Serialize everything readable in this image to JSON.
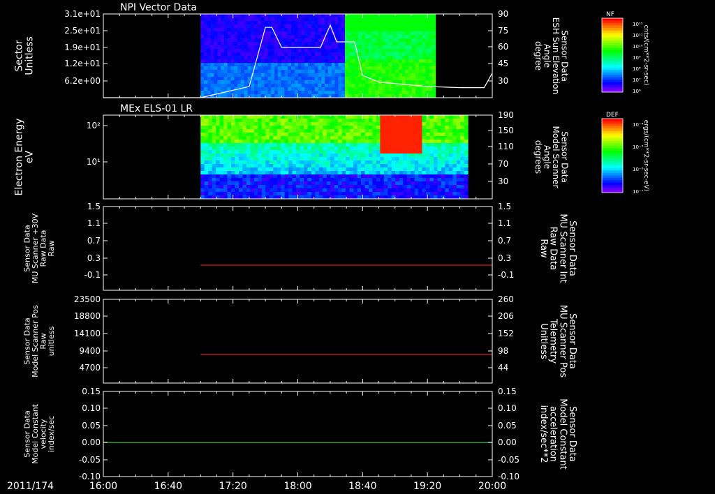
{
  "colors": {
    "background": "#000000",
    "axis": "#ffffff",
    "red_trace": "#ff2a2a",
    "green_trace": "#22dd22"
  },
  "x_axis": {
    "date_label": "2011/174",
    "ticks": [
      "16:00",
      "16:40",
      "17:20",
      "18:00",
      "18:40",
      "19:20",
      "20:00"
    ]
  },
  "chart_data": [
    {
      "type": "heatmap",
      "title": "NPI Vector Data",
      "ylabel": "Sector\nUnitless",
      "yticks": [
        "3.1e+01",
        "2.5e+01",
        "1.9e+01",
        "1.2e+01",
        "6.2e+00"
      ],
      "right_ylabel": "Sensor Data\nESH Sun Elevation\nAngle\ndegree",
      "right_yticks": [
        "90",
        "75",
        "60",
        "45",
        "30"
      ],
      "right_ylim": [
        15,
        90
      ],
      "colorbar": {
        "title": "NF",
        "units": "cnts/(cm**2-sr-sec)",
        "ticks": [
          "10¹²",
          "10¹¹",
          "10¹⁰",
          "10⁹",
          "10⁸",
          "10⁷",
          "10⁶"
        ]
      },
      "data_extent_time": [
        "17:00",
        "19:25"
      ],
      "line_series": {
        "name": "ESH Sun Elevation Angle",
        "x": [
          "16:00",
          "17:00",
          "17:30",
          "17:40",
          "17:44",
          "17:50",
          "18:00",
          "18:14",
          "18:20",
          "18:24",
          "18:35",
          "18:40",
          "18:50",
          "19:20",
          "19:40",
          "19:55",
          "20:00"
        ],
        "y": [
          15,
          15,
          25,
          78,
          78,
          60,
          60,
          60,
          80,
          65,
          65,
          35,
          29,
          25,
          24,
          24,
          37
        ]
      }
    },
    {
      "type": "heatmap",
      "title": "MEx ELS-01 LR",
      "ylabel": "Electron Energy\neV",
      "yticks": [
        "10²",
        "10¹"
      ],
      "right_ylabel": "Sensor Data\nModel Scanner\nAngle\ndegrees",
      "right_yticks": [
        "190",
        "150",
        "110",
        "70",
        "30"
      ],
      "colorbar": {
        "title": "DEF",
        "units": "ergs/(cm**2-sr-sec-eV)",
        "ticks": [
          "10⁻⁴",
          "10⁻⁵",
          "10⁻⁶",
          "10⁻⁷"
        ]
      },
      "data_extent_time": [
        "17:00",
        "19:45"
      ]
    },
    {
      "type": "line",
      "ylabel": "Sensor Data\nMU Scanner +30V\nRaw Data\nRaw",
      "yticks": [
        "1.5",
        "1.1",
        "0.7",
        "0.3",
        "-0.1"
      ],
      "ylim": [
        -0.5,
        1.5
      ],
      "right_ylabel": "Sensor Data\nMU Scanner Int\nRaw Data\nRaw",
      "right_yticks": [
        "1.5",
        "1.1",
        "0.7",
        "0.3",
        "-0.1"
      ],
      "series": [
        {
          "x": [
            "17:00",
            "20:00"
          ],
          "y": [
            0.1,
            0.1
          ]
        }
      ]
    },
    {
      "type": "line",
      "ylabel": "Sensor Data\nModel Scanner Pos\nRaw\nunitless",
      "yticks": [
        "23500",
        "18800",
        "14100",
        "9400",
        "4700"
      ],
      "ylim": [
        0,
        23500
      ],
      "right_ylabel": "Sensor Data\nMU Scanner Pos\nTelemetry\nUnitless",
      "right_yticks": [
        "260",
        "206",
        "152",
        "98",
        "44"
      ],
      "series": [
        {
          "x": [
            "17:00",
            "20:00"
          ],
          "y": [
            8000,
            8000
          ]
        }
      ]
    },
    {
      "type": "line",
      "ylabel": "Sensor Data\nModel Constant\nvelocity\nindex/sec",
      "yticks": [
        "0.15",
        "0.10",
        "0.05",
        "0.00",
        "-0.05",
        "-0.10"
      ],
      "ylim": [
        -0.1,
        0.15
      ],
      "right_ylabel": "Sensor Data\nModel Constant\nacceleration\nindex/sec**2",
      "right_yticks": [
        "0.15",
        "0.10",
        "0.05",
        "0.00",
        "-0.05",
        "-0.10"
      ],
      "series": [
        {
          "x": [
            "16:00",
            "20:00"
          ],
          "y": [
            0.0,
            0.0
          ]
        }
      ]
    }
  ]
}
